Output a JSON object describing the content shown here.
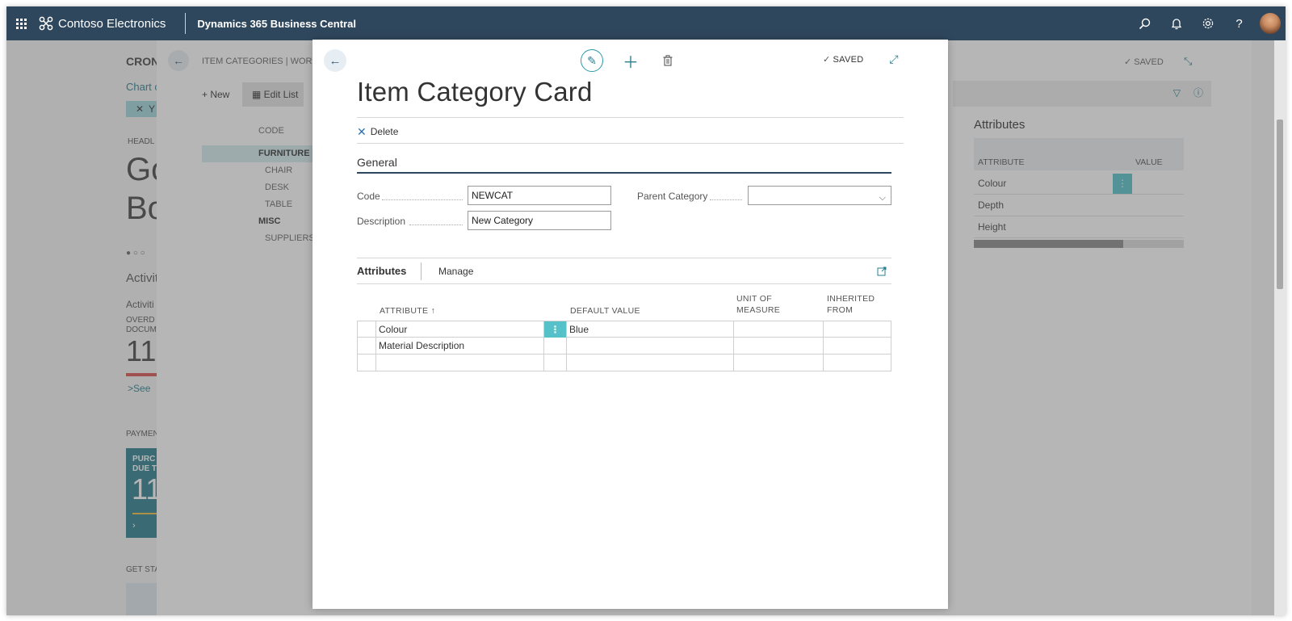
{
  "topbar": {
    "company": "Contoso Electronics",
    "product": "Dynamics 365 Business Central",
    "icons": [
      "search-icon",
      "bell-icon",
      "gear-icon",
      "help-icon",
      "avatar"
    ]
  },
  "background": {
    "left_nav": {
      "company_short": "CRON",
      "chart_link": "Chart c",
      "filter_chip": "Y",
      "headline_label": "HEADL",
      "headline_big_1": "Go",
      "headline_big_2": "Bo",
      "activities": "Activiti",
      "activities_sub": "Activiti",
      "overdue_1": "OVERD",
      "overdue_2": "DOCUM",
      "overdue_count": "11",
      "see_more": "See",
      "payments": "PAYMEN",
      "tile_text_1": "PURC",
      "tile_text_2": "DUE T",
      "tile_value": "11",
      "get_started": "GET STA"
    },
    "list_page": {
      "breadcrumb": "ITEM CATEGORIES | WORK D",
      "new_label": "New",
      "edit_list_label": "Edit List",
      "code_header": "CODE",
      "rows": [
        "FURNITURE",
        "CHAIR",
        "DESK",
        "TABLE",
        "MISC",
        "SUPPLIERS"
      ],
      "saved_label": "SAVED"
    },
    "attributes_panel": {
      "title": "Attributes",
      "col_attribute": "ATTRIBUTE",
      "col_value": "VALUE",
      "rows": [
        "Colour",
        "Depth",
        "Height"
      ],
      "scroll_fraction": 0.71
    }
  },
  "modal": {
    "title": "Item Category Card",
    "saved_label": "SAVED",
    "actions": {
      "delete_label": "Delete"
    },
    "general": {
      "section_title": "General",
      "code_label": "Code",
      "code_value": "NEWCAT",
      "description_label": "Description",
      "description_value": "New Category",
      "parent_category_label": "Parent Category",
      "parent_category_value": ""
    },
    "attributes": {
      "tab_label": "Attributes",
      "manage_label": "Manage",
      "columns": {
        "attribute": "ATTRIBUTE ↑",
        "default_value": "DEFAULT VALUE",
        "unit_of_measure_1": "UNIT OF",
        "unit_of_measure_2": "MEASURE",
        "inherited_from_1": "INHERITED",
        "inherited_from_2": "FROM"
      },
      "rows": [
        {
          "attribute": "Colour",
          "default_value": "Blue",
          "unit_of_measure": "",
          "inherited_from": ""
        },
        {
          "attribute": "Material Description",
          "default_value": "",
          "unit_of_measure": "",
          "inherited_from": ""
        },
        {
          "attribute": "",
          "default_value": "",
          "unit_of_measure": "",
          "inherited_from": ""
        }
      ]
    }
  },
  "colors": {
    "topbar": "#2f475d",
    "accent": "#2a7f8f",
    "selected_row": "#55c1c8"
  }
}
